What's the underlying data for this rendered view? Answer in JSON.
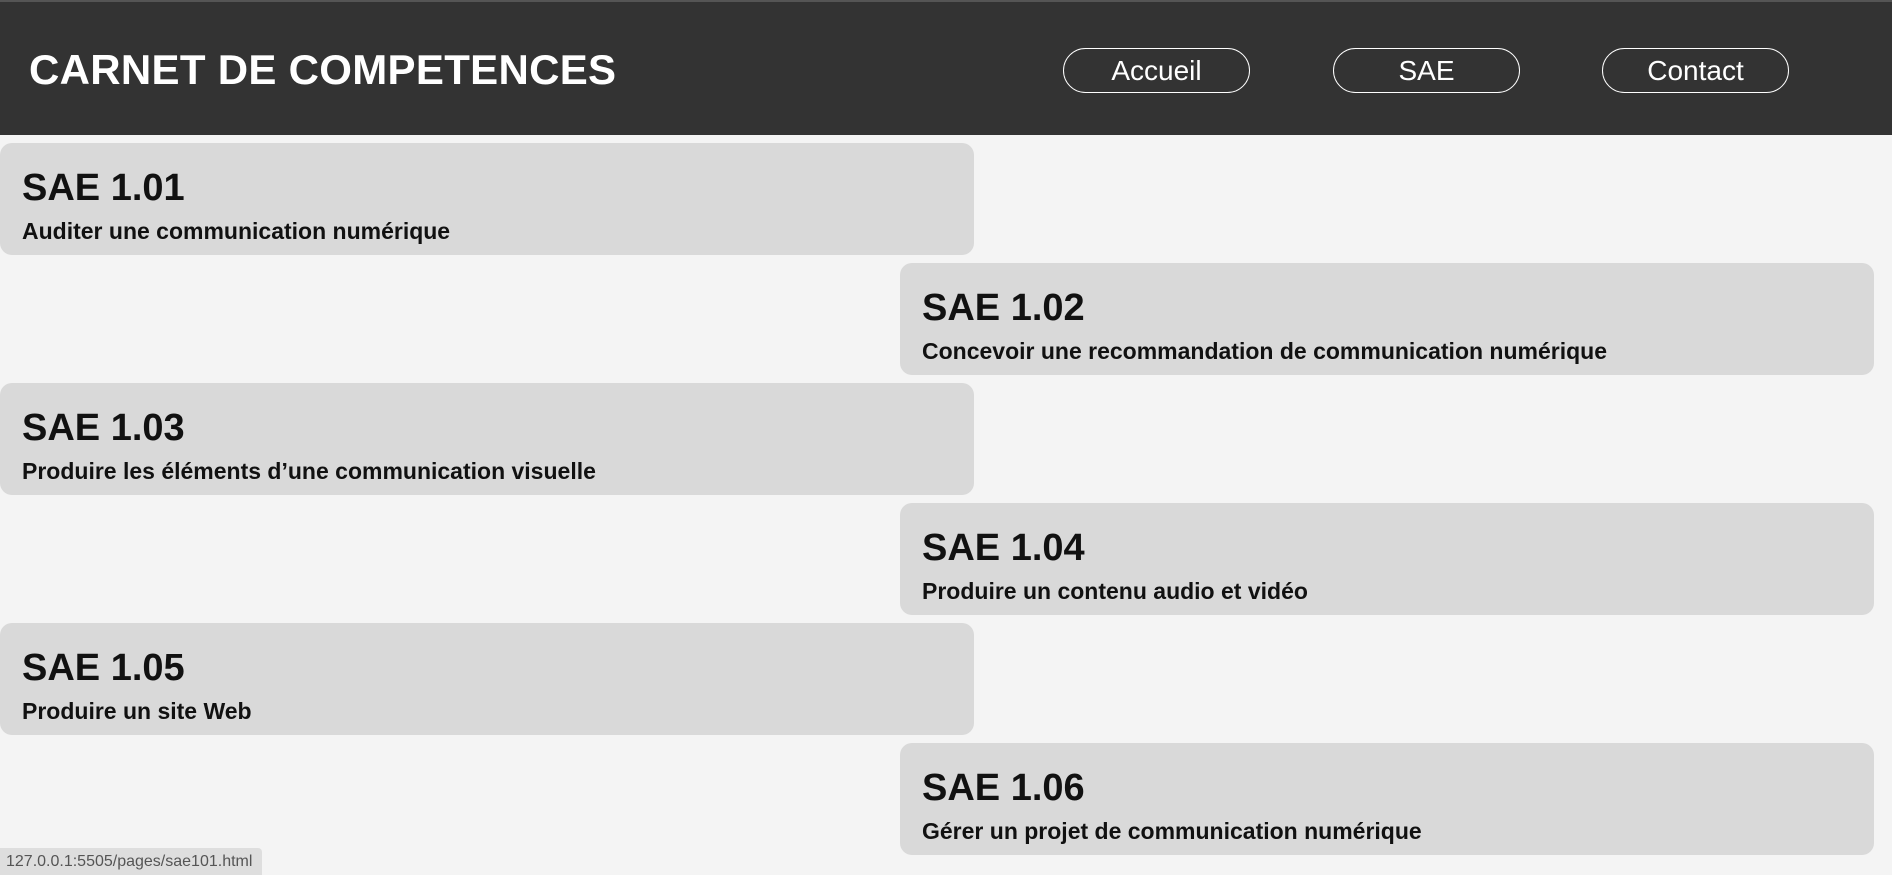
{
  "header": {
    "title": "CARNET DE COMPETENCES",
    "nav": {
      "accueil": "Accueil",
      "sae": "SAE",
      "contact": "Contact"
    }
  },
  "cards": [
    {
      "code": "SAE 1.01",
      "description": "Auditer une communication numérique"
    },
    {
      "code": "SAE 1.02",
      "description": "Concevoir une recommandation de communication numérique"
    },
    {
      "code": "SAE 1.03",
      "description": "Produire les éléments d’une communication visuelle"
    },
    {
      "code": "SAE 1.04",
      "description": "Produire un contenu audio et vidéo"
    },
    {
      "code": "SAE 1.05",
      "description": "Produire un site Web"
    },
    {
      "code": "SAE 1.06",
      "description": "Gérer un projet de communication numérique"
    }
  ],
  "status_bar": {
    "url": "127.0.0.1:5505/pages/sae101.html"
  },
  "colors": {
    "header_bg": "#333333",
    "page_bg": "#f4f4f4",
    "card_bg": "#d9d9d9",
    "text": "#111111"
  }
}
